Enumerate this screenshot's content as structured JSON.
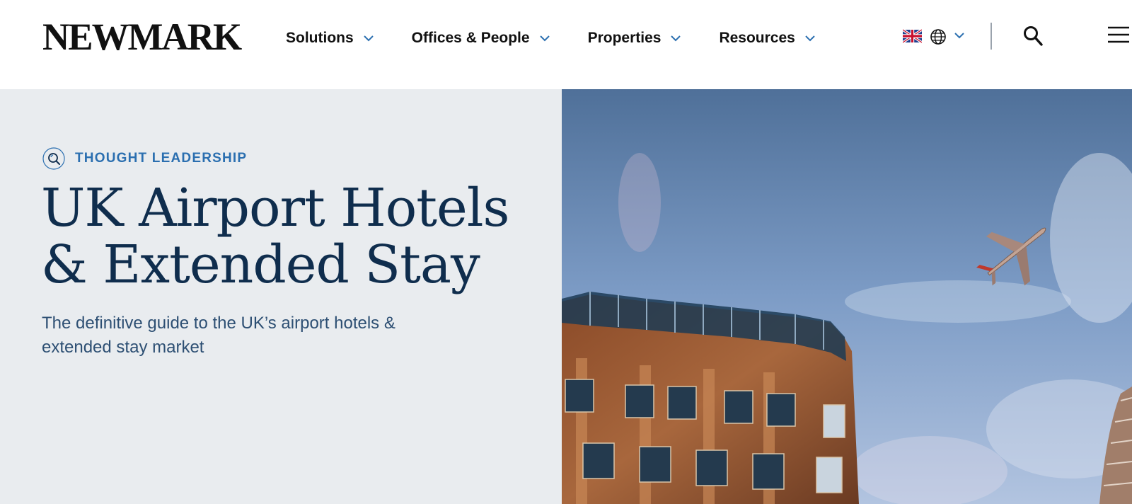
{
  "header": {
    "logo_text": "NEWMARK",
    "nav": [
      {
        "label": "Solutions"
      },
      {
        "label": "Offices & People"
      },
      {
        "label": "Properties"
      },
      {
        "label": "Resources"
      }
    ],
    "region_flag": "uk-flag-icon",
    "globe_icon": "globe-icon",
    "search_icon": "search-icon",
    "menu_icon": "hamburger-menu-icon"
  },
  "hero": {
    "tag": "THOUGHT LEADERSHIP",
    "title_line1": "UK Airport Hotels",
    "title_line2": "& Extended Stay",
    "subtitle": "The definitive guide to the UK’s airport hotels & extended stay market",
    "image_description_icon": "hero-photo"
  },
  "colors": {
    "accent_blue": "#2b6fb0",
    "title_navy": "#0f2d4d",
    "hero_bg": "#e9ecef",
    "sky": "#6d90bc"
  }
}
